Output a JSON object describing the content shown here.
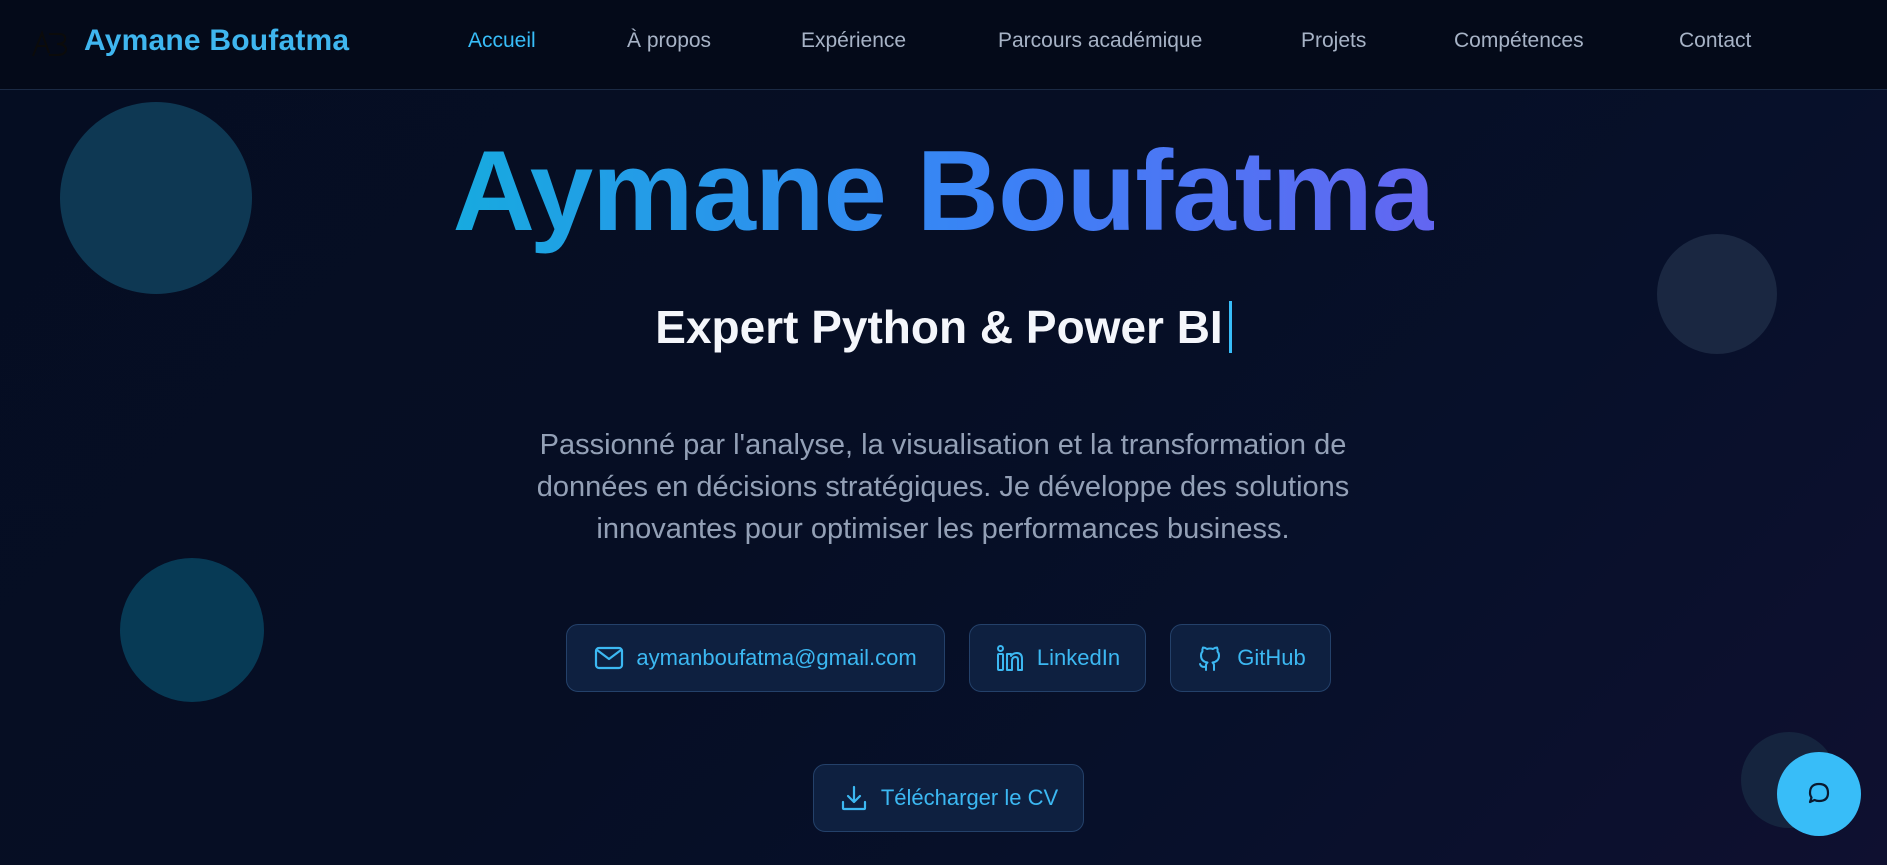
{
  "navbar": {
    "logo_icon": "ab-monogram-icon",
    "brand": "Aymane Boufatma",
    "links": [
      {
        "label": "Accueil",
        "active": true
      },
      {
        "label": "À propos",
        "active": false
      },
      {
        "label": "Expérience",
        "active": false
      },
      {
        "label": "Parcours académique",
        "active": false
      },
      {
        "label": "Projets",
        "active": false
      },
      {
        "label": "Compétences",
        "active": false
      },
      {
        "label": "Contact",
        "active": false
      }
    ]
  },
  "hero": {
    "title": "Aymane Boufatma",
    "subtitle": "Expert Python & Power BI",
    "description": "Passionné par l'analyse, la visualisation et la transformation de données en décisions stratégiques. Je développe des solutions innovantes pour optimiser les performances business.",
    "buttons": {
      "email": {
        "label": "aymanboufatma@gmail.com",
        "icon": "mail-icon"
      },
      "linkedin": {
        "label": "LinkedIn",
        "icon": "linkedin-icon"
      },
      "github": {
        "label": "GitHub",
        "icon": "github-icon"
      },
      "cv": {
        "label": "Télécharger le CV",
        "icon": "download-icon"
      }
    }
  },
  "chat": {
    "icon": "chat-bubble-icon"
  },
  "colors": {
    "accent": "#38bdf8",
    "gradient_start": "#17aadf",
    "gradient_mid": "#3b82f6",
    "gradient_end": "#6366f1",
    "background": "#050d22",
    "button_bg": "#0e2040",
    "muted_text": "#93a0b6"
  }
}
